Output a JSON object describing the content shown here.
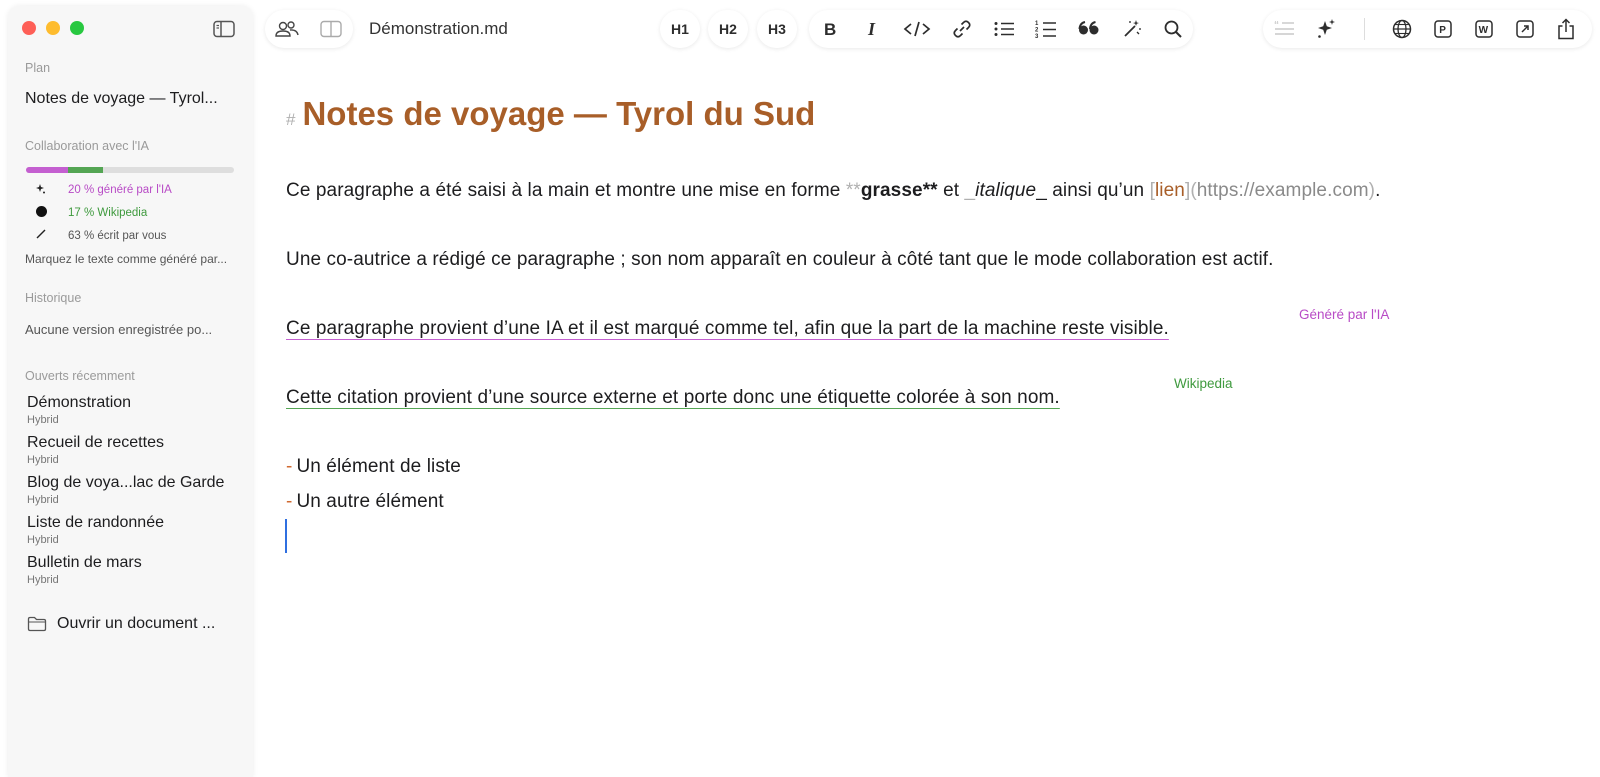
{
  "window": {
    "filename": "Démonstration.md"
  },
  "toolbar": {
    "h1": "H1",
    "h2": "H2",
    "h3": "H3",
    "icons": [
      "bold-icon",
      "italic-icon",
      "code-icon",
      "link-icon",
      "bullet-list-icon",
      "numbered-list-icon",
      "quote-icon",
      "magic-wand-icon",
      "search-icon"
    ],
    "right_icons": [
      "quote-disabled-icon",
      "sparkles-icon",
      "globe-icon",
      "p-export-icon",
      "w-export-icon",
      "open-external-icon",
      "share-icon"
    ]
  },
  "sidebar": {
    "plan_heading": "Plan",
    "plan_title": "Notes de voyage — Tyrol...",
    "collab_heading": "Collaboration avec l'IA",
    "collab": {
      "ai_percent": 20,
      "wiki_percent": 17,
      "you_percent": 63,
      "ai_label": "20 % généré par l'IA",
      "wiki_label": "17 % Wikipedia",
      "you_label": "63 % écrit par vous",
      "hint": "Marquez le texte comme généré par..."
    },
    "history_heading": "Historique",
    "history_text": "Aucune version enregistrée po...",
    "recent_heading": "Ouverts récemment",
    "recent": [
      {
        "name": "Démonstration",
        "sub": "Hybrid"
      },
      {
        "name": "Recueil de recettes",
        "sub": "Hybrid"
      },
      {
        "name": "Blog de voya...lac de Garde",
        "sub": "Hybrid"
      },
      {
        "name": "Liste de randonnée",
        "sub": "Hybrid"
      },
      {
        "name": "Bulletin de mars",
        "sub": "Hybrid"
      }
    ],
    "open_doc": "Ouvrir un document ..."
  },
  "colors": {
    "heading": "#a85e28",
    "ai": "#c45fd0",
    "wiki": "#54a553",
    "caret": "#2f6fe0"
  },
  "editor": {
    "hash": "#",
    "title": "Notes de voyage — Tyrol du Sud",
    "p1": {
      "a": "Ce paragraphe a été saisi à la main et montre une mise en forme ",
      "bold_open": "**",
      "bold_text": "grasse",
      "bold_close": "**",
      "b": " et ",
      "ital_open": "_",
      "ital_text": "italique",
      "ital_close": "_",
      "c": " ainsi qu’un ",
      "link_open": "[",
      "link_text": "lien",
      "link_mid": "](",
      "link_url": "https://example.com",
      "link_close": ")",
      "d": "."
    },
    "p2": "Une co-autrice a rédigé ce paragraphe ; son nom apparaît en couleur à côté tant que le mode collaboration est actif.",
    "p3": "Ce paragraphe provient d’une IA et il est marqué comme tel, afin que la part de la machine reste visible.",
    "p3_tag": "Généré par l'IA",
    "p4": "Cette citation provient d’une source externe et porte donc une étiquette colorée à son nom.",
    "p4_tag": "Wikipedia",
    "list_dash": "-",
    "list": [
      "Un élément de liste",
      "Un autre élément"
    ]
  }
}
